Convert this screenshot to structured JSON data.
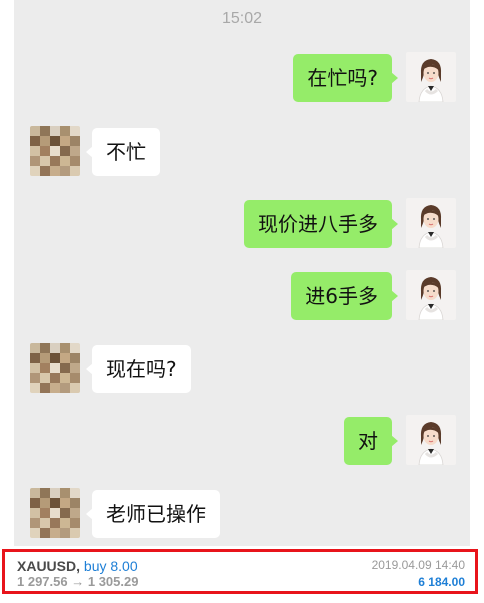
{
  "chat": {
    "timestamp": "15:02",
    "messages": [
      {
        "side": "out",
        "text": "在忙吗?"
      },
      {
        "side": "in",
        "text": "不忙"
      },
      {
        "side": "out",
        "text": "现价进八手多"
      },
      {
        "side": "out",
        "text": "进6手多"
      },
      {
        "side": "in",
        "text": "现在吗?"
      },
      {
        "side": "out",
        "text": "对"
      },
      {
        "side": "in",
        "text": "老师已操作"
      }
    ]
  },
  "trade": {
    "symbol": "XAUUSD,",
    "direction": "buy 8.00",
    "open_price": "1 297.56",
    "arrow": "→",
    "close_price": "1 305.29",
    "datetime": "2019.04.09 14:40",
    "profit": "6 184.00",
    "highlight_color": "#e8141b",
    "accent_color": "#1e7fd6"
  },
  "colors": {
    "outgoing_bubble": "#95ec69",
    "incoming_bubble": "#ffffff",
    "chat_background": "#ececec"
  },
  "icons": {
    "outgoing_avatar": "woman-portrait-avatar",
    "incoming_avatar": "pixelated-avatar"
  }
}
